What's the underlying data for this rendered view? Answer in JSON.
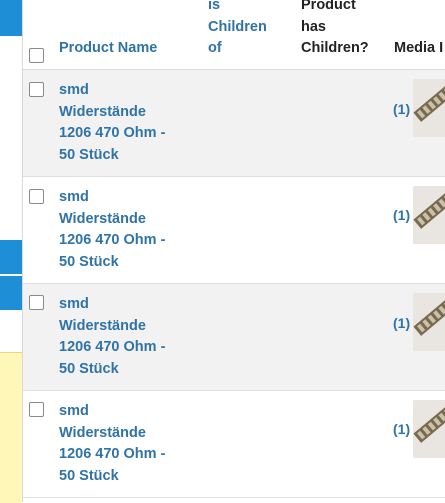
{
  "columns": {
    "product_name": "Product Name",
    "is_children_of": [
      "is",
      "Children",
      "of"
    ],
    "product_has_children": [
      "Product",
      "has",
      "Children?"
    ],
    "media": "Media I"
  },
  "rows": [
    {
      "name": [
        "smd",
        "Widerstände",
        "1206 470 Ohm -",
        "50 Stück"
      ],
      "media_count": "(1)"
    },
    {
      "name": [
        "smd",
        "Widerstände",
        "1206 470 Ohm -",
        "50 Stück"
      ],
      "media_count": "(1)"
    },
    {
      "name": [
        "smd",
        "Widerstände",
        "1206 470 Ohm -",
        "50 Stück"
      ],
      "media_count": "(1)"
    },
    {
      "name": [
        "smd",
        "Widerstände",
        "1206 470 Ohm -",
        "50 Stück"
      ],
      "media_count": "(1)"
    }
  ],
  "colors": {
    "link": "#2f73a8",
    "accent_blue": "#1e8fd6",
    "highlight_yellow": "#fff7b8"
  }
}
